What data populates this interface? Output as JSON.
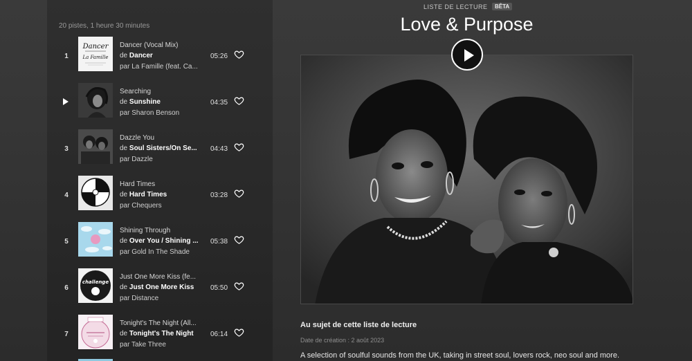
{
  "playlist": {
    "summary": "20 pistes, 1 heure 30 minutes",
    "kicker": "LISTE DE LECTURE",
    "badge": "BÊTA",
    "title": "Love & Purpose",
    "about_heading": "Au sujet de cette liste de lecture",
    "created": "Date de création : 2 août 2023",
    "description": "A selection of soulful sounds from the UK, taking in street soul, lovers rock, neo soul and more."
  },
  "tracks": [
    {
      "num": "1",
      "title": "Dancer (Vocal Mix)",
      "from_prefix": "de ",
      "album": "Dancer",
      "by": "par La Famille (feat. Ca...",
      "duration": "05:26",
      "playing": false
    },
    {
      "num": "2",
      "title": "Searching",
      "from_prefix": "de ",
      "album": "Sunshine",
      "by": "par Sharon Benson",
      "duration": "04:35",
      "playing": true
    },
    {
      "num": "3",
      "title": "Dazzle You",
      "from_prefix": "de ",
      "album": "Soul Sisters/On Se...",
      "by": "par Dazzle",
      "duration": "04:43",
      "playing": false
    },
    {
      "num": "4",
      "title": "Hard Times",
      "from_prefix": "de ",
      "album": "Hard Times",
      "by": "par Chequers",
      "duration": "03:28",
      "playing": false
    },
    {
      "num": "5",
      "title": "Shining Through",
      "from_prefix": "de ",
      "album": "Over You / Shining ...",
      "by": "par Gold In The Shade",
      "duration": "05:38",
      "playing": false
    },
    {
      "num": "6",
      "title": "Just One More Kiss (fe...",
      "from_prefix": "de ",
      "album": "Just One More Kiss",
      "by": "par Distance",
      "duration": "05:50",
      "playing": false
    },
    {
      "num": "7",
      "title": "Tonight's The Night (All...",
      "from_prefix": "de ",
      "album": "Tonight's The Night",
      "by": "par Take Three",
      "duration": "06:14",
      "playing": false
    }
  ],
  "icons": {
    "heart": "heart-outline-icon",
    "play": "play-icon"
  },
  "colors": {
    "background": "#353535",
    "text": "#ffffff",
    "muted": "#9a9a9a"
  }
}
